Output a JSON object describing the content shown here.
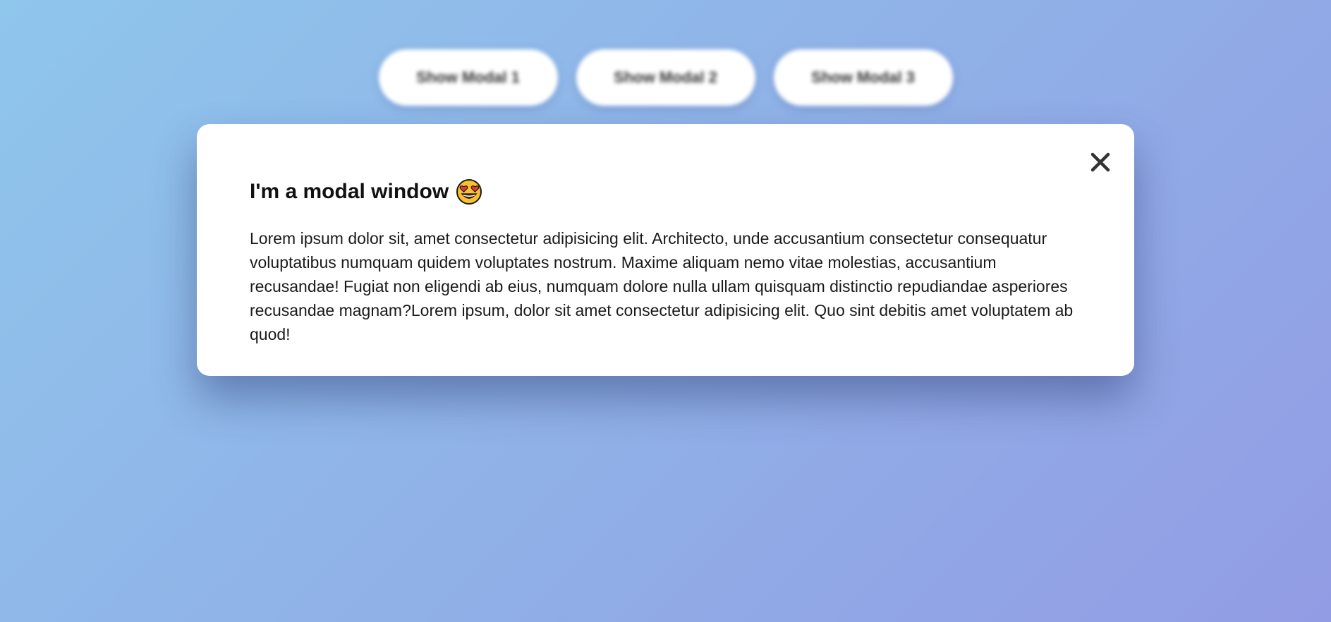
{
  "buttons": [
    {
      "label": "Show Modal 1"
    },
    {
      "label": "Show Modal 2"
    },
    {
      "label": "Show Modal 3"
    }
  ],
  "modal": {
    "title": "I'm a modal window",
    "title_icon": "heart-eyes-emoji-icon",
    "close_icon": "close-icon",
    "body": "Lorem ipsum dolor sit, amet consectetur adipisicing elit. Architecto, unde accusantium consectetur consequatur voluptatibus numquam quidem voluptates nostrum. Maxime aliquam nemo vitae molestias, accusantium recusandae! Fugiat non eligendi ab eius, numquam dolore nulla ullam quisquam distinctio repudiandae asperiores recusandae magnam?Lorem ipsum, dolor sit amet consectetur adipisicing elit. Quo sint debitis amet voluptatem ab quod!"
  },
  "colors": {
    "background_start": "#8fc6ec",
    "background_end": "#929ce4",
    "modal_background": "#ffffff",
    "text": "#111111"
  }
}
